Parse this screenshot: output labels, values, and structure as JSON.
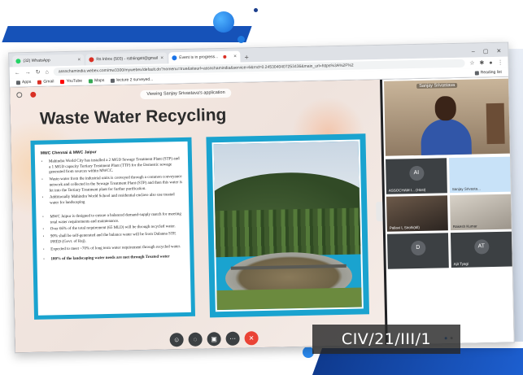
{
  "colors": {
    "frame_blue": "#1652b8",
    "slide_panel": "#1aa3cf",
    "end_call": "#ea4335"
  },
  "browser": {
    "tabs": [
      {
        "label": "(32) WhatsApp",
        "icon": "whatsapp-icon"
      },
      {
        "label": "Rs Inbox (503) - rsthlingstt@gmail",
        "icon": "gmail-icon"
      },
      {
        "label": "Event is in progress...",
        "icon": "webex-icon",
        "active": true
      }
    ],
    "url": "assochamindia.webex.com/mw3300/mywebex/default.do?nomenu=true&siteurl=assochamindia&service=6&rnd=0.2453040407253436&main_url=https%3A%2F%2",
    "bookmarks": [
      "Apps",
      "Gmail",
      "YouTube",
      "Maps",
      "lecture 2 surveyed..."
    ],
    "reading_list": "Reading list"
  },
  "meeting": {
    "viewing_text": "Viewing Sanjay Srivastava's application",
    "slide": {
      "title": "Waste Water Recycling",
      "panel_heading": "MWC Chennai & MWC Jaipur",
      "bullets": [
        "Mahindra World City has installed a 2 MGD Sewage Treatment Plant (STP) and a 1 MGD capacity Tertiary Treatment Plant (TTP) for the Domestic sewage generated from sources within MWCC.",
        "Waste-water from the industrial units is conveyed through a common conveyance network and collected in the Sewage Treatment Plant (STP) and then this water is let into the Tertiary Treatment plant for further purification.",
        "Additionally Mahindra World School and residential enclave also use treated water for landscaping"
      ],
      "bullets_2": [
        "MWC Jaipur is designed to ensure a balanced demand-supply match for meeting total water requirements and maintenance.",
        "Over 66% of the total requirement (65 MLD) will be through recycled water.",
        "90% shall be self-generated and the balance water will be from Dalanna STP, PHED (Govt. of Raj).",
        "Expected to meet ~70% of long term water requirement through recycled water."
      ],
      "closing_bullet": "100% of the landscaping water needs are met through Treated water"
    },
    "speaker_name": "Sanjay Srivastava",
    "participants": [
      {
        "initials": "AI",
        "name": "ASSOCHAM I... (Host)",
        "style": "grey"
      },
      {
        "initials": "",
        "name": "Sanjay Srivasta...",
        "style": "blue"
      },
      {
        "initials": "",
        "name": "Pallavi L Sirohi(all)",
        "style": "cam1"
      },
      {
        "initials": "",
        "name": "Rakesh Kumar",
        "style": "cam2"
      },
      {
        "initials": "D",
        "name": "",
        "style": "grey"
      },
      {
        "initials": "AT",
        "name": "Ajit Tyagi",
        "style": "grey"
      }
    ],
    "controls": [
      "participants-icon",
      "chat-icon",
      "share-icon",
      "more-icon",
      "end-call-icon"
    ]
  },
  "code_label": "CIV/21/III/1"
}
